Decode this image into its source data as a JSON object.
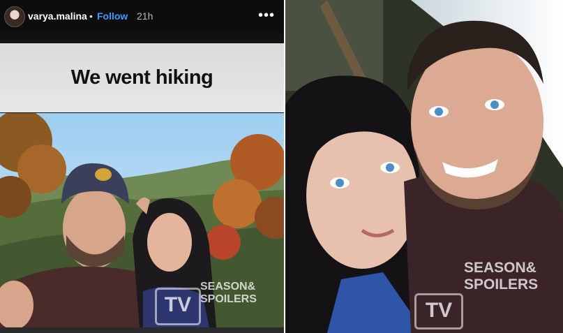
{
  "story": {
    "username": "varya.malina",
    "separator": "•",
    "follow_label": "Follow",
    "time_ago": "21h",
    "more_icon": "more-horizontal-icon",
    "caption": "We went hiking"
  },
  "watermark": {
    "logo": "TV",
    "text_line1": "SEASON&",
    "text_line2": "SPOILERS"
  },
  "colors": {
    "follow": "#3d9bff",
    "header_bg": "#0d0d0d",
    "caption_bg": "#e0e1e2"
  }
}
